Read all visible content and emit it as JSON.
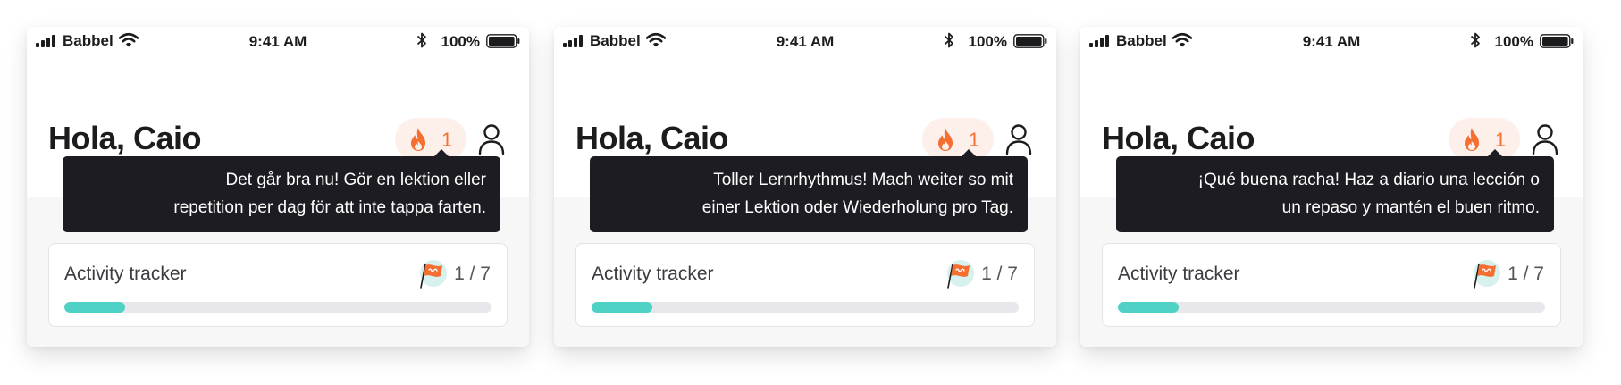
{
  "screens": [
    {
      "status_bar": {
        "carrier": "Babbel",
        "time": "9:41 AM",
        "battery": "100%"
      },
      "greeting": "Hola, Caio",
      "streak": {
        "count": "1"
      },
      "tooltip": {
        "lines": [
          "Det går bra nu! Gör en lektion eller",
          "repetition per dag för att inte tappa farten."
        ]
      },
      "activity_tracker": {
        "title": "Activity tracker",
        "count": "1 / 7",
        "progress": 0.143
      }
    },
    {
      "status_bar": {
        "carrier": "Babbel",
        "time": "9:41 AM",
        "battery": "100%"
      },
      "greeting": "Hola, Caio",
      "streak": {
        "count": "1"
      },
      "tooltip": {
        "lines": [
          "Toller Lernrhythmus! Mach weiter so mit",
          "einer Lektion oder Wiederholung pro Tag."
        ]
      },
      "activity_tracker": {
        "title": "Activity tracker",
        "count": "1 / 7",
        "progress": 0.143
      }
    },
    {
      "status_bar": {
        "carrier": "Babbel",
        "time": "9:41 AM",
        "battery": "100%"
      },
      "greeting": "Hola, Caio",
      "streak": {
        "count": "1"
      },
      "tooltip": {
        "lines": [
          "¡Qué buena racha! Haz a diario una lección o",
          "un repaso y mantén el buen ritmo."
        ]
      },
      "activity_tracker": {
        "title": "Activity tracker",
        "count": "1 / 7",
        "progress": 0.143
      }
    }
  ],
  "icons": {
    "signal": "cellular-signal-icon",
    "wifi": "wifi-icon",
    "bluetooth": "bluetooth-icon",
    "battery": "battery-icon",
    "streak": "flame-icon",
    "profile": "profile-icon",
    "tracker": "flag-icon"
  },
  "colors": {
    "accent_orange": "#f56f33",
    "streak_pill_bg": "#fdf0ea",
    "progress_fill": "#4fd1c5",
    "tooltip_bg": "#1c1c22"
  }
}
